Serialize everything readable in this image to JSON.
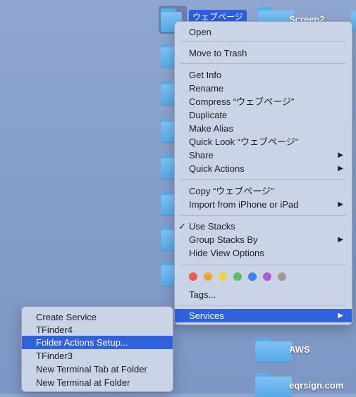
{
  "desktop": {
    "selected_folder_label": "ウェブページ",
    "labels": [
      "Screen2",
      "AWS",
      "eqrsign.com"
    ]
  },
  "context_menu": {
    "open": "Open",
    "move_to_trash": "Move to Trash",
    "get_info": "Get Info",
    "rename": "Rename",
    "compress": "Compress “ウェブページ”",
    "duplicate": "Duplicate",
    "make_alias": "Make Alias",
    "quick_look": "Quick Look “ウェブページ”",
    "share": "Share",
    "quick_actions": "Quick Actions",
    "copy": "Copy “ウェブページ”",
    "import_from_iphone": "Import from iPhone or iPad",
    "use_stacks": "Use Stacks",
    "group_stacks_by": "Group Stacks By",
    "hide_view_options": "Hide View Options",
    "tags": "Tags...",
    "services": "Services",
    "checkmark": "✓",
    "submenu_arrow": "▶",
    "tag_colors": [
      "#ec5b4f",
      "#f5a623",
      "#f1d33a",
      "#5cc15a",
      "#3b82f6",
      "#a75fd6",
      "#9b9b9b"
    ]
  },
  "services_submenu": {
    "items": [
      "Create Service",
      "TFinder4",
      "Folder Actions Setup...",
      "TFinder3",
      "New Terminal Tab at Folder",
      "New Terminal at Folder"
    ]
  }
}
